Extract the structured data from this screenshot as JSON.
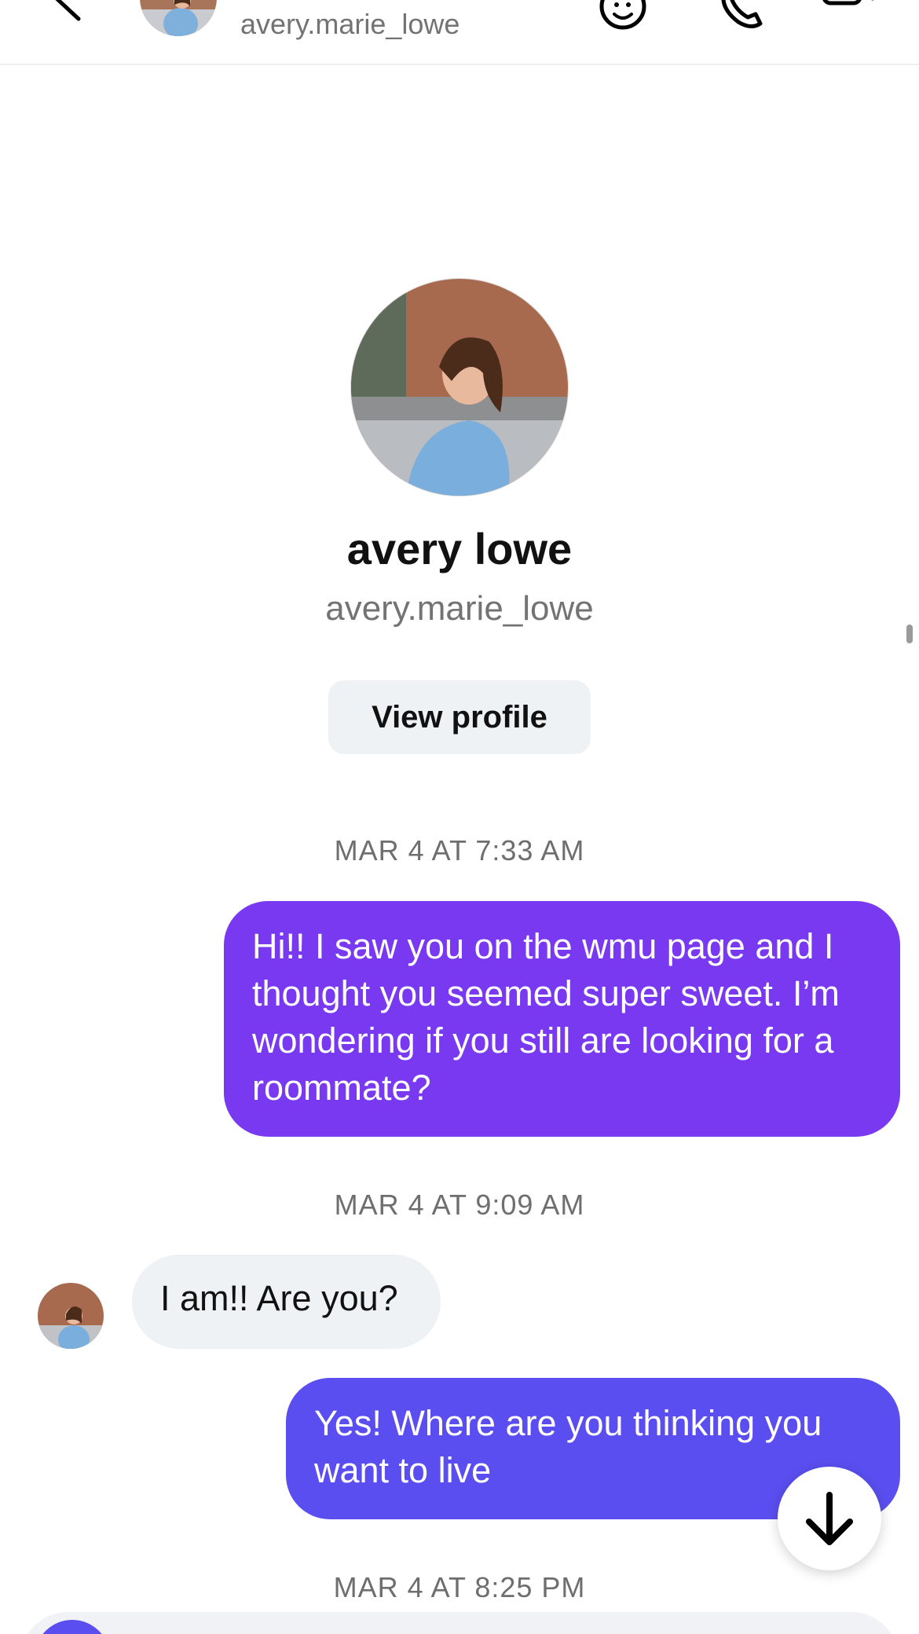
{
  "header": {
    "username": "avery.marie_lowe"
  },
  "profile": {
    "display_name": "avery lowe",
    "username": "avery.marie_lowe",
    "view_profile_label": "View profile"
  },
  "messages": [
    {
      "timestamp": "MAR 4 AT 7:33 AM",
      "direction": "outgoing",
      "text": "Hi!! I saw you on the wmu page and I thought you seemed super sweet. I’m wondering if you still are looking for a roommate?"
    },
    {
      "timestamp": "MAR 4 AT 9:09 AM",
      "direction": "incoming",
      "text": "I am!! Are you?"
    },
    {
      "direction": "outgoing",
      "text": "Yes! Where are you thinking you want to live"
    }
  ],
  "next_timestamp": "MAR 4 AT 8:25 PM",
  "colors": {
    "outgoing_bubble_1": "#7839f0",
    "outgoing_bubble_2": "#5a4ef0",
    "incoming_bubble": "#eff2f5"
  },
  "icons": [
    "back-icon",
    "sticker-icon",
    "phone-icon",
    "video-icon",
    "arrow-down-icon"
  ]
}
